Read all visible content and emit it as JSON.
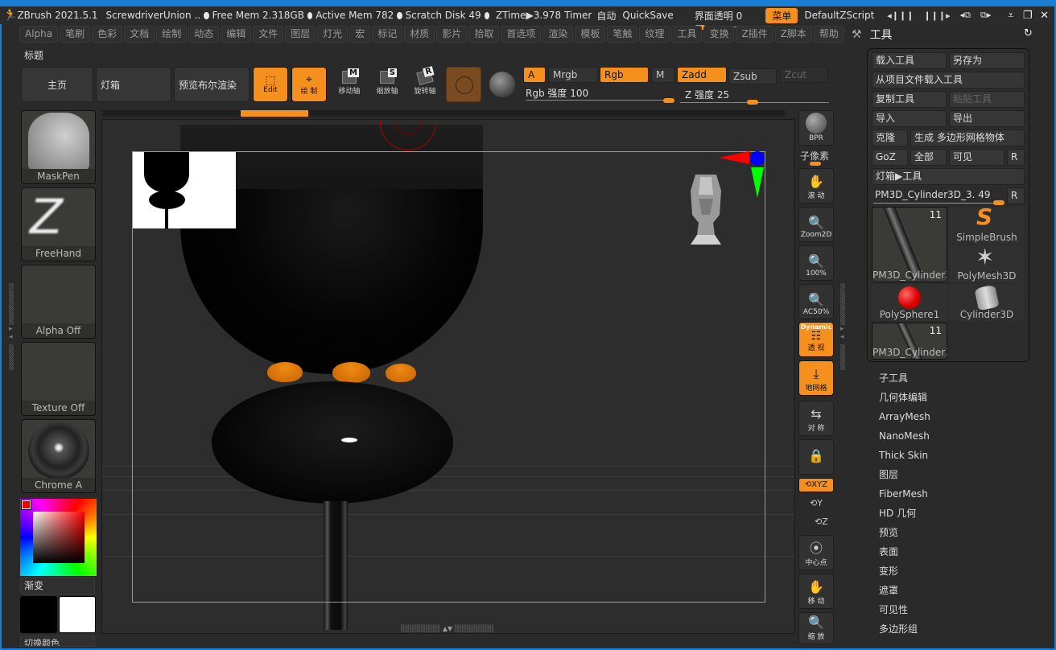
{
  "titlebar": {
    "app": "ZBrush 2021.5.1",
    "project": "ScrewdriverUnion",
    "ellipsis": "..",
    "free_mem": "Free Mem 2.318GB",
    "active_mem": "Active Mem 782",
    "scratch_disk": "Scratch Disk 49",
    "ztime": "ZTime▶3.978",
    "timer": "Timer",
    "auto": "自动",
    "quicksave": "QuickSave",
    "ui_opacity_label": "界面透明 0",
    "ui_opacity_value": 0,
    "menu_button": "菜单",
    "default_zscript": "DefaultZScript",
    "icons": [
      "shrink-left-icon",
      "shrink-right-icon",
      "layout-prev-icon",
      "layout-next-icon",
      "minimize-icon",
      "restore-icon",
      "close-icon"
    ]
  },
  "menubar": {
    "items": [
      "Alpha",
      "笔刷",
      "色彩",
      "文档",
      "绘制",
      "动态",
      "编辑",
      "文件",
      "图层",
      "灯光",
      "宏",
      "标记",
      "材质",
      "影片",
      "拾取",
      "首选项",
      "渲染",
      "模板",
      "笔触",
      "纹理",
      "工具",
      "变换",
      "Z插件",
      "Z脚本",
      "帮助"
    ]
  },
  "tool_panel_title": "工具",
  "header": {
    "title_label": "标题",
    "home": "主页",
    "lightbox": "灯箱",
    "preview_boolean": "预览布尔渲染",
    "edit": "Edit",
    "draw": "绘 制",
    "move": "移动轴",
    "move_key": "M",
    "scale": "缩放轴",
    "scale_key": "S",
    "rotate": "旋转轴",
    "rotate_key": "R"
  },
  "color_modes": {
    "a": "A",
    "mrgb": "Mrgb",
    "rgb": "Rgb",
    "m": "M",
    "zadd": "Zadd",
    "zsub": "Zsub",
    "zcut": "Zcut",
    "rgb_intensity_label": "Rgb 强度 100",
    "rgb_intensity": 100,
    "z_intensity_label": "Z 强度 25",
    "z_intensity": 25
  },
  "left_shelf": {
    "brush": "MaskPen",
    "stroke": "FreeHand",
    "alpha": "Alpha Off",
    "texture": "Texture Off",
    "material": "Chrome A",
    "gradient": "渐变",
    "main_color": "#000000",
    "secondary_color": "#ffffff",
    "switch_color": "切换颜色",
    "picker_color": "#ee0000"
  },
  "right_shelf": {
    "bpr": "BPR",
    "subpixel": "子像素",
    "scroll": "滚 动",
    "zoom2d": "Zoom2D",
    "actual": "100%",
    "ac50": "AC50%",
    "dynamic": "Dynamic",
    "perspective": "透 视",
    "floor": "地网格",
    "symmetry": "对 称",
    "xyz": "XYZ",
    "y": "Y",
    "z": "Z",
    "center": "中心点",
    "move": "移 动",
    "zoom": "缩 放"
  },
  "tool_palette": {
    "load_tool": "载入工具",
    "save_as": "另存为",
    "load_from_project": "从项目文件载入工具",
    "copy_tool": "复制工具",
    "paste_tool": "粘贴工具",
    "import": "导入",
    "export": "导出",
    "clone": "克隆",
    "make_polymesh": "生成 多边形网格物体",
    "goz": "GoZ",
    "all": "全部",
    "visible": "可见",
    "r": "R",
    "lightbox_tools": "灯箱▶工具",
    "current_tool": "PM3D_Cylinder3D_3. 49",
    "current_tool_value": 49,
    "tools": [
      {
        "name": "PM3D_Cylinder3",
        "count": "11"
      },
      {
        "name": "SimpleBrush",
        "count": ""
      },
      {
        "name": "PolyMesh3D",
        "count": ""
      },
      {
        "name": "PolySphere1",
        "count": ""
      },
      {
        "name": "Cylinder3D",
        "count": ""
      },
      {
        "name": "PM3D_Cylinder3",
        "count": "11"
      }
    ]
  },
  "subpalettes": [
    "子工具",
    "几何体编辑",
    "ArrayMesh",
    "NanoMesh",
    "Thick Skin",
    "图层",
    "FiberMesh",
    "HD 几何",
    "预览",
    "表面",
    "变形",
    "遮罩",
    "可见性",
    "多边形组"
  ],
  "colors": {
    "accent": "#f5901f",
    "window_border": "#1a7fd4",
    "background": "#2a2a2a"
  }
}
